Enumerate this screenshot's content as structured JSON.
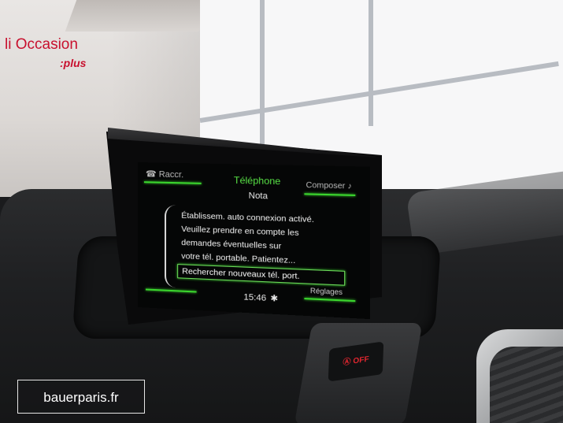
{
  "background": {
    "sign_text": "li Occasion",
    "sign_plus": ":plus"
  },
  "screen": {
    "header": {
      "left_label": "Raccr.",
      "title": "Téléphone",
      "right_label": "Composer"
    },
    "subtitle": "Nota",
    "message_lines": [
      "Établissem. auto connexion activé.",
      "Veuillez prendre en compte les",
      "demandes éventuelles sur",
      "votre tél. portable. Patientez..."
    ],
    "selected_option": "Rechercher nouveaux tél. port.",
    "settings_label": "Réglages",
    "time": "15:46",
    "bluetooth_symbol": "✱"
  },
  "console": {
    "startstop_label": "Ⓐ OFF"
  },
  "watermark": "bauerparis.fr",
  "colors": {
    "accent_green": "#3bd62e",
    "title_green": "#58e246",
    "sign_red": "#c8102e"
  }
}
